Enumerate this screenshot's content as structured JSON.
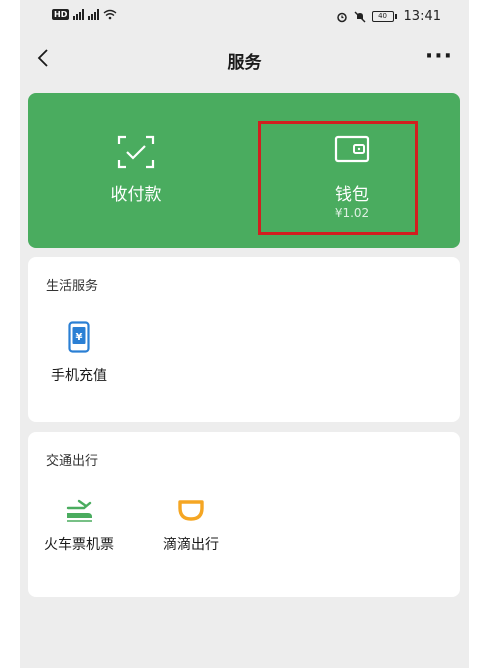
{
  "status_bar": {
    "hd": "HD",
    "sig1": "5G",
    "sig2": "2G",
    "battery": "40",
    "time": "13:41"
  },
  "nav": {
    "title": "服务",
    "more": "···"
  },
  "wallet_panel": {
    "pay": {
      "label": "收付款",
      "icon": "qr-scan-icon"
    },
    "wallet": {
      "label": "钱包",
      "balance": "¥1.02",
      "icon": "wallet-icon"
    }
  },
  "life_services": {
    "title": "生活服务",
    "items": [
      {
        "label": "手机充值",
        "icon": "phone-recharge-icon"
      }
    ]
  },
  "transport": {
    "title": "交通出行",
    "items": [
      {
        "label": "火车票机票",
        "icon": "train-plane-icon"
      },
      {
        "label": "滴滴出行",
        "icon": "didi-icon"
      }
    ]
  },
  "colors": {
    "accent_green": "#4aac5f",
    "highlight_red": "#d11f1f",
    "icon_blue": "#2a7fd4",
    "icon_orange": "#f5a623"
  }
}
